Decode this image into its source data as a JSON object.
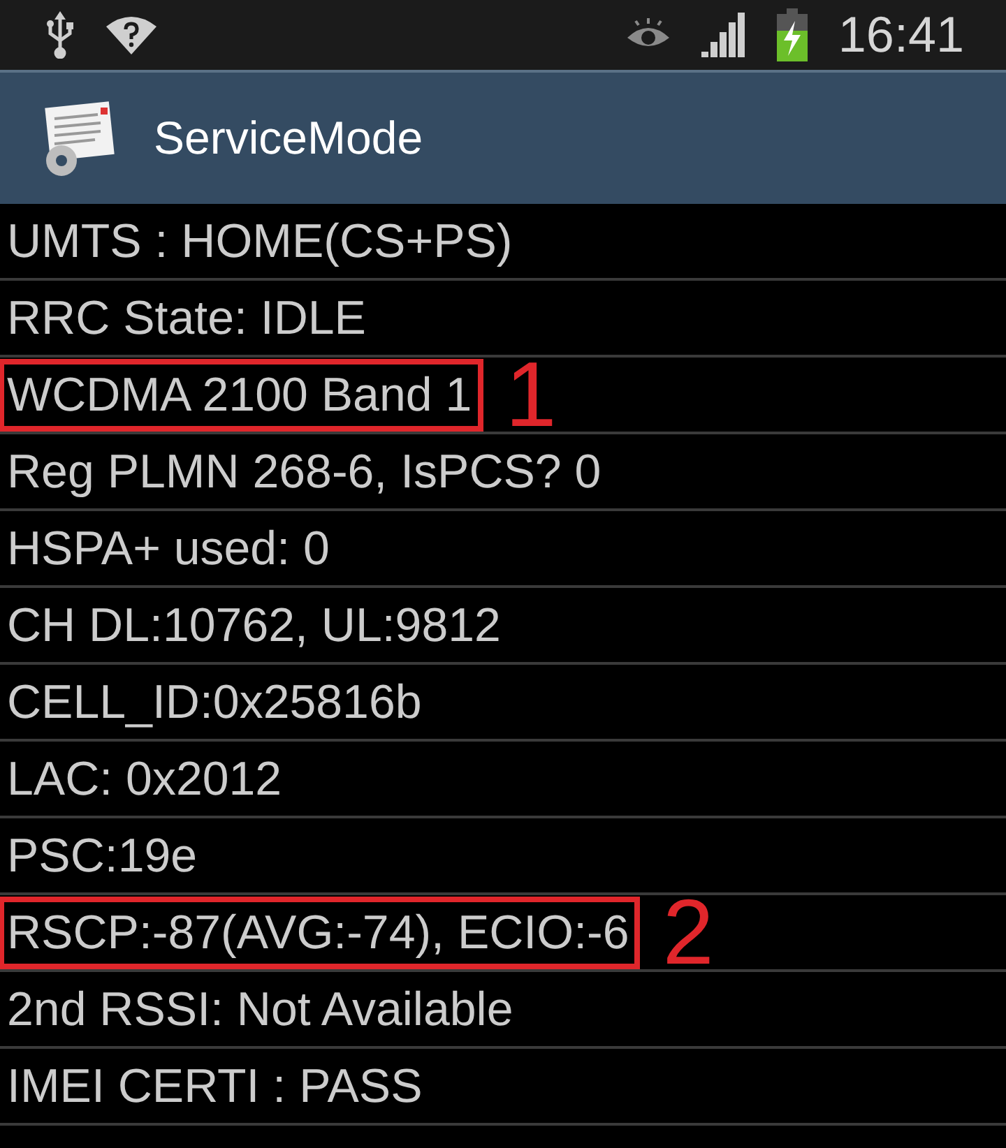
{
  "status_bar": {
    "time": "16:41"
  },
  "app_bar": {
    "title": "ServiceMode"
  },
  "rows": [
    {
      "text": "UMTS : HOME(CS+PS)",
      "highlighted": false
    },
    {
      "text": "RRC State: IDLE",
      "highlighted": false
    },
    {
      "text": "WCDMA 2100 Band 1",
      "highlighted": true,
      "annotation": "1"
    },
    {
      "text": "Reg PLMN 268-6, IsPCS? 0",
      "highlighted": false
    },
    {
      "text": "HSPA+ used: 0",
      "highlighted": false
    },
    {
      "text": "CH DL:10762, UL:9812",
      "highlighted": false
    },
    {
      "text": "CELL_ID:0x25816b",
      "highlighted": false
    },
    {
      "text": "LAC: 0x2012",
      "highlighted": false
    },
    {
      "text": "PSC:19e",
      "highlighted": false
    },
    {
      "text": "RSCP:-87(AVG:-74), ECIO:-6",
      "highlighted": true,
      "annotation": "2"
    },
    {
      "text": "2nd RSSI: Not Available",
      "highlighted": false
    },
    {
      "text": "IMEI CERTI : PASS",
      "highlighted": false
    }
  ]
}
